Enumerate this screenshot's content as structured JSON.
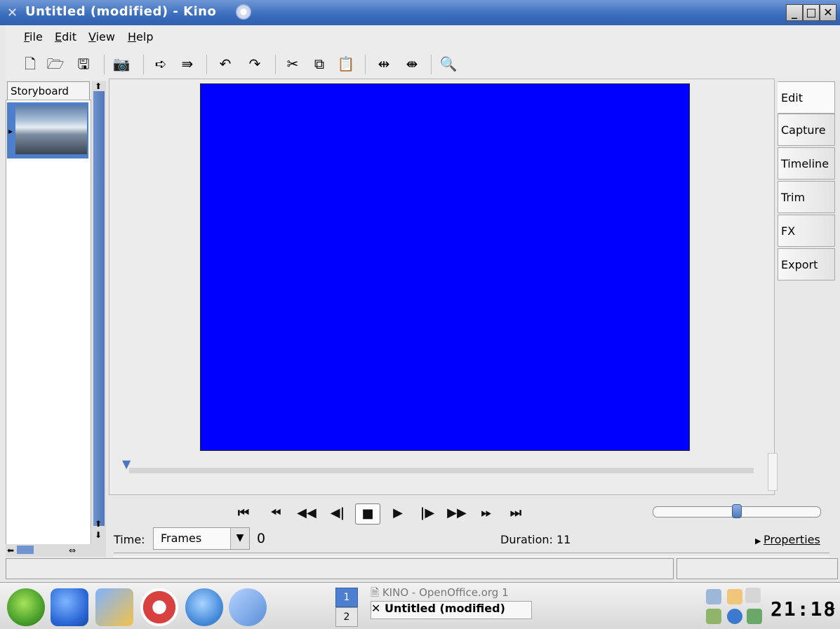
{
  "window": {
    "title": "Untitled (modified)  - Kino"
  },
  "menubar": {
    "items": [
      "File",
      "Edit",
      "View",
      "Help"
    ]
  },
  "toolbar": {
    "icons": [
      "new-file-icon",
      "open-folder-icon",
      "save-icon",
      "camera-icon",
      "import-icon",
      "export-icon",
      "undo-icon",
      "redo-icon",
      "cut-icon",
      "copy-icon",
      "paste-icon",
      "split-icon",
      "join-icon",
      "zoom-icon"
    ]
  },
  "storyboard": {
    "tab_label": "Storyboard"
  },
  "right_tabs": {
    "items": [
      "Edit",
      "Capture",
      "Timeline",
      "Trim",
      "FX",
      "Export"
    ]
  },
  "controls": {
    "time_label": "Time:",
    "time_format": "Frames",
    "current_time": "0",
    "duration": "Duration: 11",
    "properties": "Properties"
  },
  "taskbar": {
    "pager": [
      "1",
      "2"
    ],
    "tasks": [
      "KINO - OpenOffice.org 1",
      "Untitled (modified)"
    ],
    "clock": "21:18"
  },
  "colors": {
    "video": "#0000ff",
    "accent": "#4c7fd0"
  }
}
